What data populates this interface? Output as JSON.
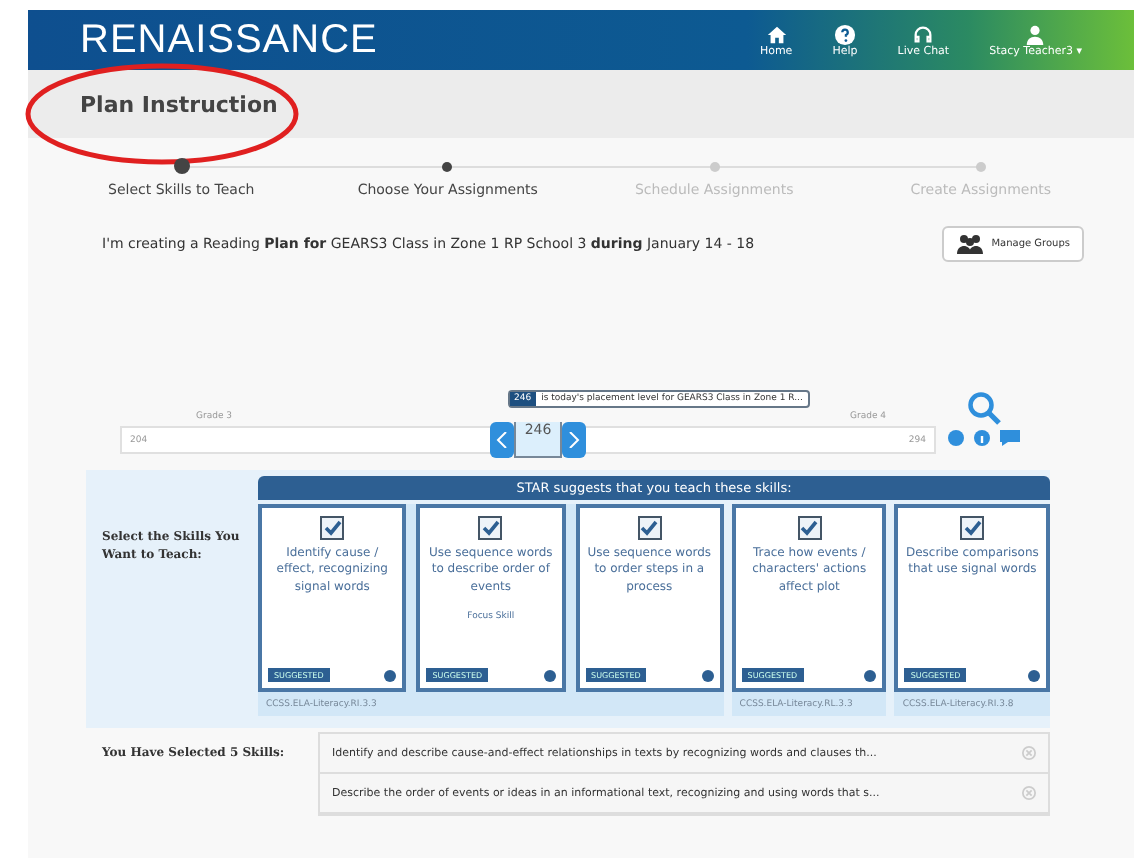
{
  "header": {
    "logo": "RENAISSANCE",
    "nav": [
      {
        "kind": "home",
        "label": "Home"
      },
      {
        "kind": "help",
        "label": "Help"
      },
      {
        "kind": "chat",
        "label": "Live Chat"
      },
      {
        "kind": "user",
        "label": "Stacy Teacher3",
        "caret": "▾"
      }
    ]
  },
  "page_title": "Plan Instruction",
  "steps": [
    {
      "label": "Select Skills to Teach",
      "reached": true,
      "selected": true
    },
    {
      "label": "Choose Your Assignments",
      "reached": true,
      "selected": false
    },
    {
      "label": "Schedule Assignments",
      "reached": false,
      "selected": false
    },
    {
      "label": "Create Assignments",
      "reached": false,
      "selected": false
    }
  ],
  "plan_sentence": "I'm creating a Reading  **Plan for** GEARS3 Class in Zone 1 RP School 3  **during** January 14 - 18",
  "manage_groups": "Manage Groups",
  "scale": {
    "placement_badge": "246",
    "placement_text": "is today's placement level for GEARS3 Class in Zone 1 R...",
    "grade_left": "Grade 3",
    "grade_right": "Grade 4",
    "min": "204",
    "max": "294",
    "value": "246"
  },
  "skills_label": "Select the Skills You Want to Teach:",
  "banner": "STAR suggests that you teach these skills:",
  "skill_groups": [
    {
      "standard": "CCSS.ELA-Literacy.RI.3.3",
      "skills": [
        {
          "text": "Identify cause / effect, recognizing signal words",
          "checked": true,
          "badge": "SUGGESTED"
        },
        {
          "text": "Use sequence words to describe order of events",
          "checked": true,
          "focus": "Focus Skill",
          "badge": "SUGGESTED"
        },
        {
          "text": "Use sequence words to order steps in a process",
          "checked": true,
          "badge": "SUGGESTED"
        }
      ]
    },
    {
      "standard": "CCSS.ELA-Literacy.RL.3.3",
      "skills": [
        {
          "text": "Trace how events / characters' actions affect plot",
          "checked": true,
          "badge": "SUGGESTED"
        }
      ]
    },
    {
      "standard": "CCSS.ELA-Literacy.RI.3.8",
      "skills": [
        {
          "text": "Describe comparisons that use signal words",
          "checked": true,
          "badge": "SUGGESTED"
        }
      ]
    }
  ],
  "selected_label": "You Have Selected 5 Skills:",
  "selected_skills": [
    "Identify and describe cause-and-effect relationships in texts by recognizing words and clauses th...",
    "Describe the order of events or ideas in an informational text, recognizing and using words that s..."
  ]
}
